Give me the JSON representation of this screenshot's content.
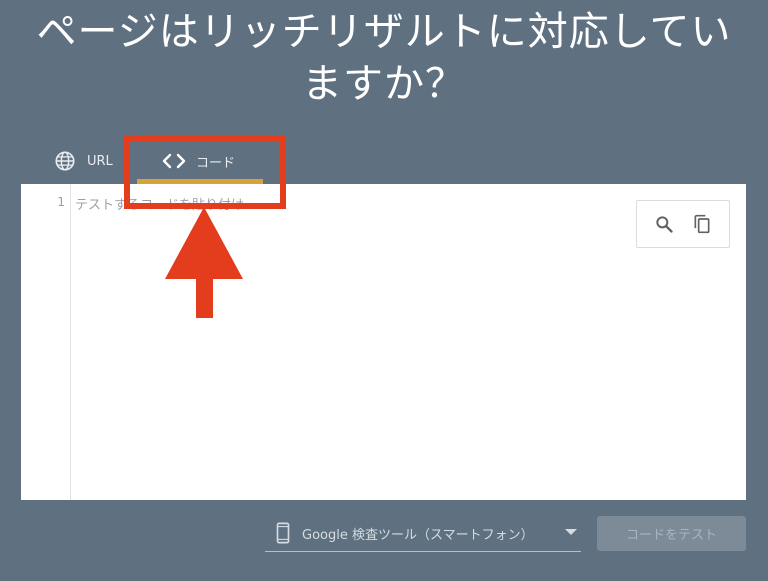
{
  "page": {
    "title_line1": "ページはリッチリザルトに対応してい",
    "title_line2": "ますか？"
  },
  "tabs": [
    {
      "label": "URL",
      "icon": "globe-icon",
      "selected": false
    },
    {
      "label": "コード",
      "icon": "code-icon",
      "selected": true
    }
  ],
  "editor": {
    "line_number": "1",
    "placeholder": "テストするコードを貼り付け",
    "tools": [
      "search-icon",
      "copy-icon"
    ]
  },
  "device_select": {
    "icon": "smartphone-icon",
    "value": "Google 検査ツール（スマートフォン）"
  },
  "actions": {
    "test_label": "コードをテスト"
  },
  "colors": {
    "background": "#5f7080",
    "tab_underline": "#d7a23b",
    "annotation_red": "#e33d1e",
    "button_disabled": "#7d8b99"
  }
}
